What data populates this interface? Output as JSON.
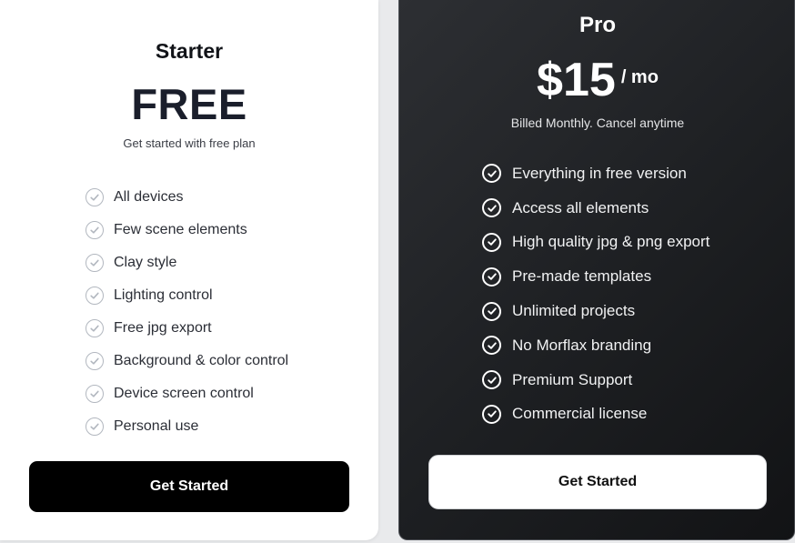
{
  "starter": {
    "name": "Starter",
    "price": "FREE",
    "subtitle": "Get started with free plan",
    "features": [
      "All devices",
      "Few scene elements",
      "Clay style",
      "Lighting control",
      "Free jpg export",
      "Background & color control",
      "Device screen control",
      "Personal use"
    ],
    "button_label": "Get Started",
    "check_icon": "check-circle-icon"
  },
  "pro": {
    "name": "Pro",
    "price": "$15",
    "period": "/ mo",
    "subtitle": "Billed Monthly. Cancel anytime",
    "features": [
      "Everything in free version",
      "Access all elements",
      "High quality jpg & png export",
      "Pre-made templates",
      "Unlimited projects",
      "No Morflax branding",
      "Premium Support",
      "Commercial license"
    ],
    "button_label": "Get Started",
    "check_icon": "check-circle-icon"
  },
  "colors": {
    "starter_bg": "#ffffff",
    "pro_bg": "#1f2124",
    "starter_button": "#000000",
    "pro_button": "#ffffff",
    "check_light": "#b2b7bf",
    "check_dark": "#ffffff"
  }
}
